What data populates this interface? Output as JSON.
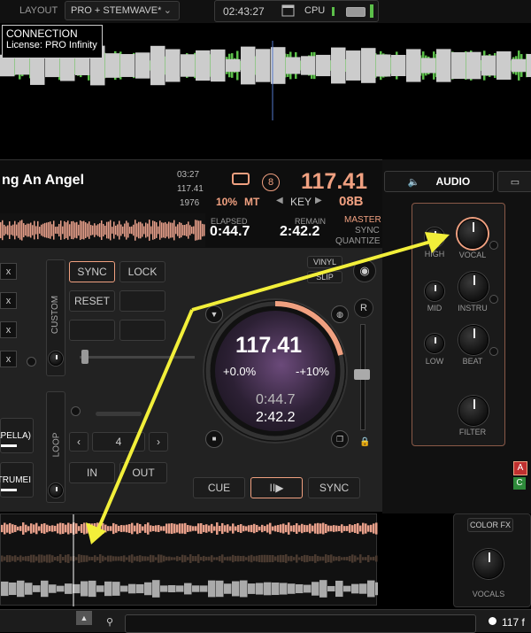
{
  "topbar": {
    "layout_label": "LAYOUT",
    "layout_value": "PRO + STEMWAVE*",
    "time": "02:43:27",
    "cpu_label": "CPU"
  },
  "tooltip": {
    "line1": "CONNECTION",
    "line2": "License: PRO Infinity"
  },
  "track": {
    "title": "ng An Angel",
    "length": "03:27",
    "bpm_small": "117.41",
    "year": "1976"
  },
  "deck": {
    "pitch_pct": "10%",
    "mode": "MT",
    "deck_number": "8",
    "bpm": "117.41",
    "key_label": "KEY",
    "key_value": "08B",
    "elapsed_label": "ELAPSED",
    "elapsed": "0:44.7",
    "remain_label": "REMAIN",
    "remain": "2:42.2",
    "master": "MASTER",
    "sync": "SYNC",
    "quantize": "QUANTIZE"
  },
  "controls": {
    "sync": "SYNC",
    "lock": "LOCK",
    "reset": "RESET",
    "custom": "CUSTOM",
    "loop": "LOOP",
    "loop_size": "4",
    "in": "IN",
    "out": "OUT",
    "vinyl": "VINYL",
    "slip": "SLIP",
    "r": "R",
    "cue": "CUE",
    "play_pause": "II▶",
    "sync_bottom": "SYNC",
    "x": "x",
    "acapella": "APELLA)",
    "instrumental": "TRUMEI"
  },
  "jog": {
    "bpm": "117.41",
    "pitch": "+0.0%",
    "range": "-+10%",
    "elapsed": "0:44.7",
    "remain": "2:42.2"
  },
  "audio_panel": {
    "tab_audio": "AUDIO",
    "high": "HIGH",
    "vocal": "VOCAL",
    "mid": "MID",
    "instru": "INSTRU",
    "low": "LOW",
    "beat": "BEAT",
    "filter": "FILTER"
  },
  "side_letters": {
    "a": "A",
    "c": "C"
  },
  "color_fx": {
    "title": "COLOR FX",
    "vocals": "VOCALS"
  },
  "bottom": {
    "count": "117 f"
  },
  "colors": {
    "accent": "#f0a080",
    "green": "#5cc04a",
    "yellow_arrow": "#f2ef3a"
  }
}
